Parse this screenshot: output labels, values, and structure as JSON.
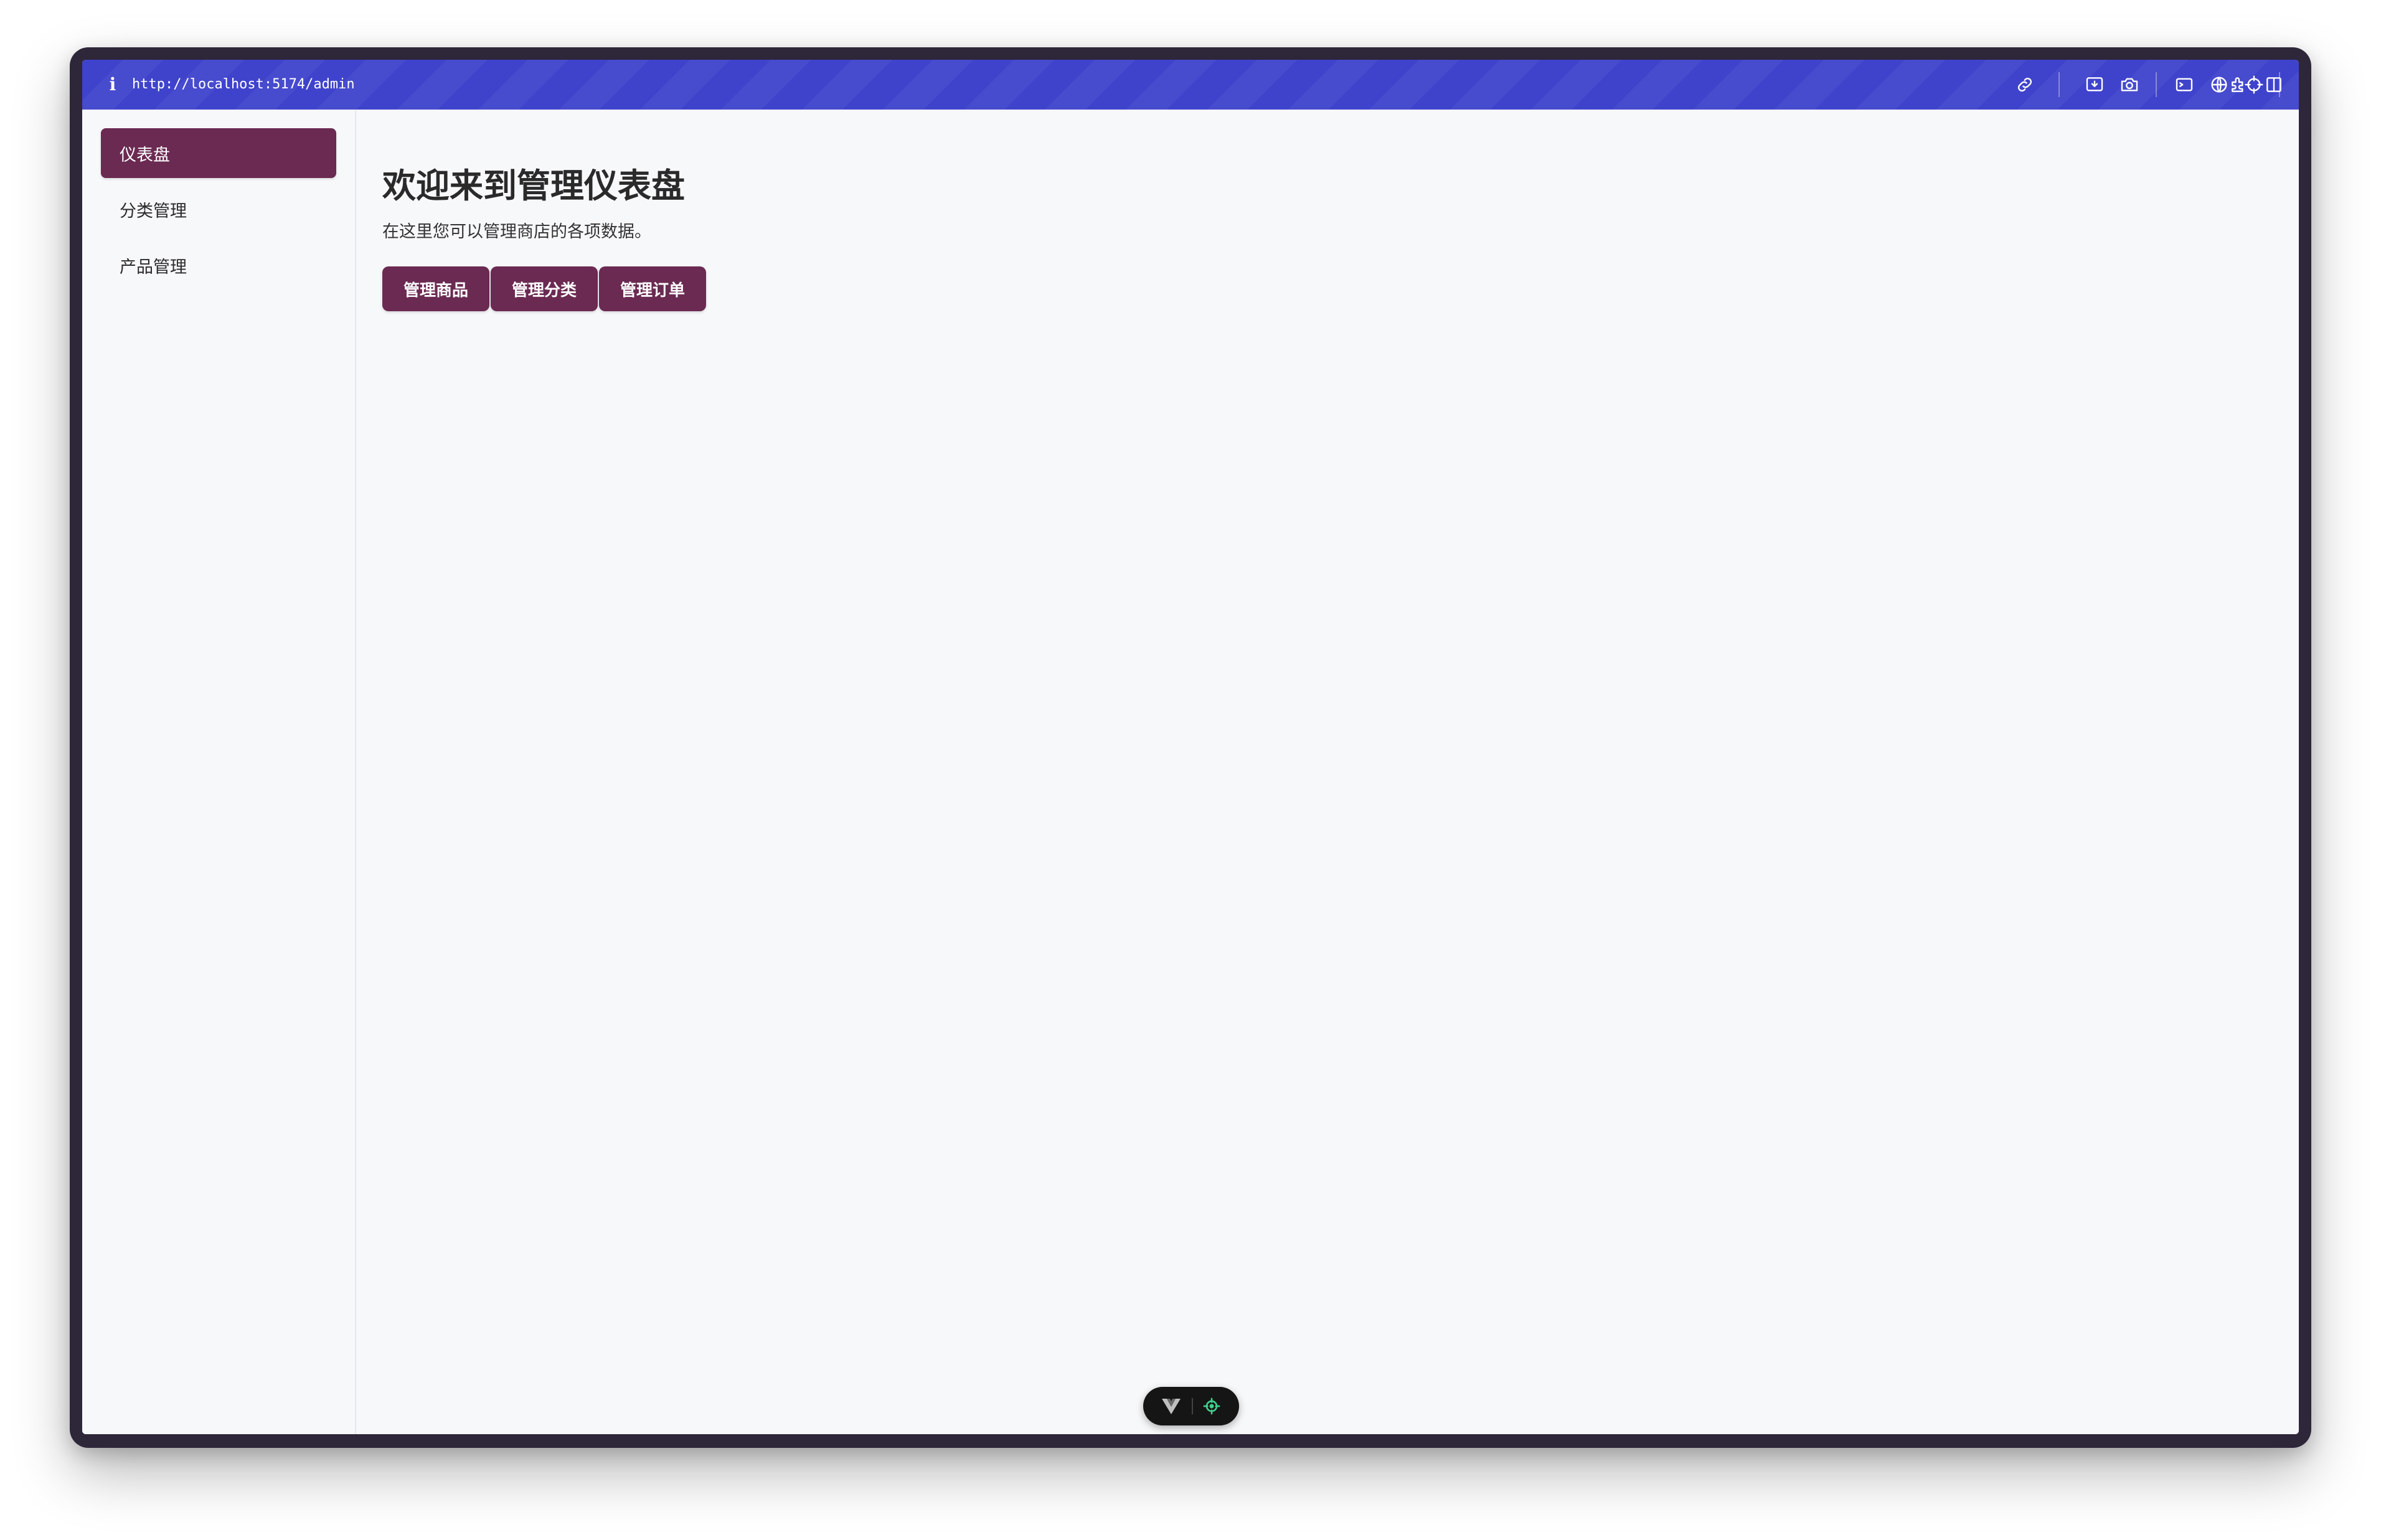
{
  "browser": {
    "info_icon": "i",
    "url": "http://localhost:5174/admin",
    "toolbar_icons": [
      "link-icon",
      "download-icon",
      "camera-icon",
      "terminal-icon",
      "globe-icon",
      "crosshair-icon",
      "extensions-icon",
      "split-view-icon"
    ],
    "accent_color": "#3f43cc"
  },
  "sidebar": {
    "items": [
      {
        "label": "仪表盘",
        "active": true
      },
      {
        "label": "分类管理",
        "active": false
      },
      {
        "label": "产品管理",
        "active": false
      }
    ]
  },
  "main": {
    "title": "欢迎来到管理仪表盘",
    "description": "在这里您可以管理商店的各项数据。",
    "actions": [
      {
        "label": "管理商品"
      },
      {
        "label": "管理分类"
      },
      {
        "label": "管理订单"
      }
    ]
  },
  "theme": {
    "primary_color": "#6b2a52",
    "background_color": "#f7f8fa"
  },
  "devtools": {
    "icons": [
      "vue-logo-icon",
      "inspect-target-icon"
    ]
  }
}
